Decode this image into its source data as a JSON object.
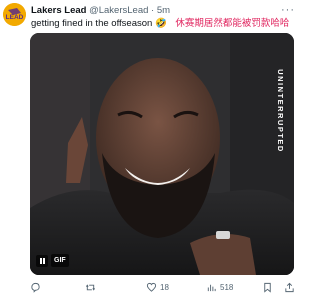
{
  "author": {
    "name": "Lakers Lead",
    "handle": "@LakersLead",
    "separator": "·",
    "time": "5m",
    "avatar_label": "LEAD"
  },
  "tweet": {
    "text": "getting fined in the offseason 🤣",
    "text_cn": "休赛期居然都能被罚款哈哈"
  },
  "media": {
    "badge": "GIF",
    "watermark": "UNINTERRUPTED"
  },
  "actions": {
    "reply_count": "",
    "retweet_count": "",
    "like_count": "18",
    "views_count": "518"
  },
  "colors": {
    "accent_text": "#e0245e",
    "muted": "#536471",
    "avatar_bg": "#f0a500"
  }
}
